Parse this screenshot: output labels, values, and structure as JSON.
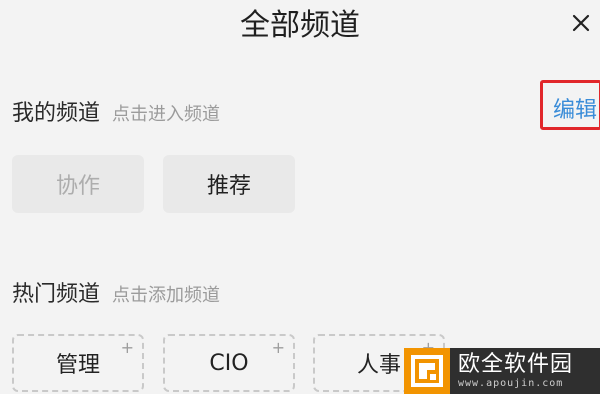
{
  "header": {
    "title": "全部频道",
    "close_icon": "close-icon"
  },
  "my_channels": {
    "title": "我的频道",
    "hint": "点击进入频道",
    "edit_label": "编辑",
    "edit_highlight_color": "#e1262a",
    "items": [
      {
        "label": "协作",
        "state": "disabled"
      },
      {
        "label": "推荐",
        "state": "normal"
      }
    ]
  },
  "hot_channels": {
    "title": "热门频道",
    "hint": "点击添加频道",
    "add_icon": "plus-icon",
    "items": [
      {
        "label": "管理"
      },
      {
        "label": "CIO"
      },
      {
        "label": "人事"
      }
    ]
  },
  "watermark": {
    "name": "欧全软件园",
    "domain": "www.apoujin.com",
    "logo_color": "#f29400"
  },
  "colors": {
    "accent_link": "#3a8cd8",
    "background": "#f3f3f3"
  }
}
